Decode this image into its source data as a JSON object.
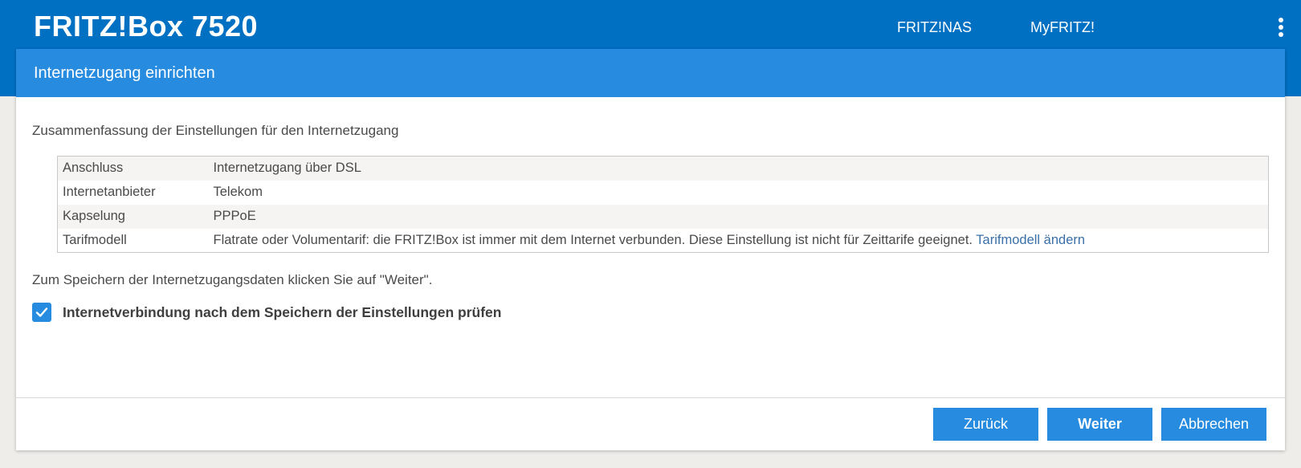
{
  "header": {
    "brand": "FRITZ!Box 7520",
    "nav": [
      "FRITZ!NAS",
      "MyFRITZ!"
    ],
    "menu_icon": "kebab-menu-icon"
  },
  "panel": {
    "title": "Internetzugang einrichten",
    "intro": "Zusammenfassung der Einstellungen für den Internetzugang",
    "summary": [
      {
        "key": "Anschluss",
        "value": "Internetzugang über DSL"
      },
      {
        "key": "Internetanbieter",
        "value": "Telekom"
      },
      {
        "key": "Kapselung",
        "value": "PPPoE"
      },
      {
        "key": "Tarifmodell",
        "value": "Flatrate oder Volumentarif: die FRITZ!Box ist immer mit dem Internet verbunden. Diese Einstellung ist nicht für Zeittarife geeignet.",
        "link": "Tarifmodell ändern"
      }
    ],
    "save_note": "Zum Speichern der Internetzugangsdaten klicken Sie auf \"Weiter\".",
    "checkbox": {
      "label": "Internetverbindung nach dem Speichern der Einstellungen prüfen",
      "checked": true
    }
  },
  "buttons": {
    "back": "Zurück",
    "next": "Weiter",
    "cancel": "Abbrechen"
  },
  "colors": {
    "header_bg": "#0070c3",
    "panel_head_bg": "#278be0",
    "button_bg": "#278be0",
    "link": "#3a6fa8"
  }
}
